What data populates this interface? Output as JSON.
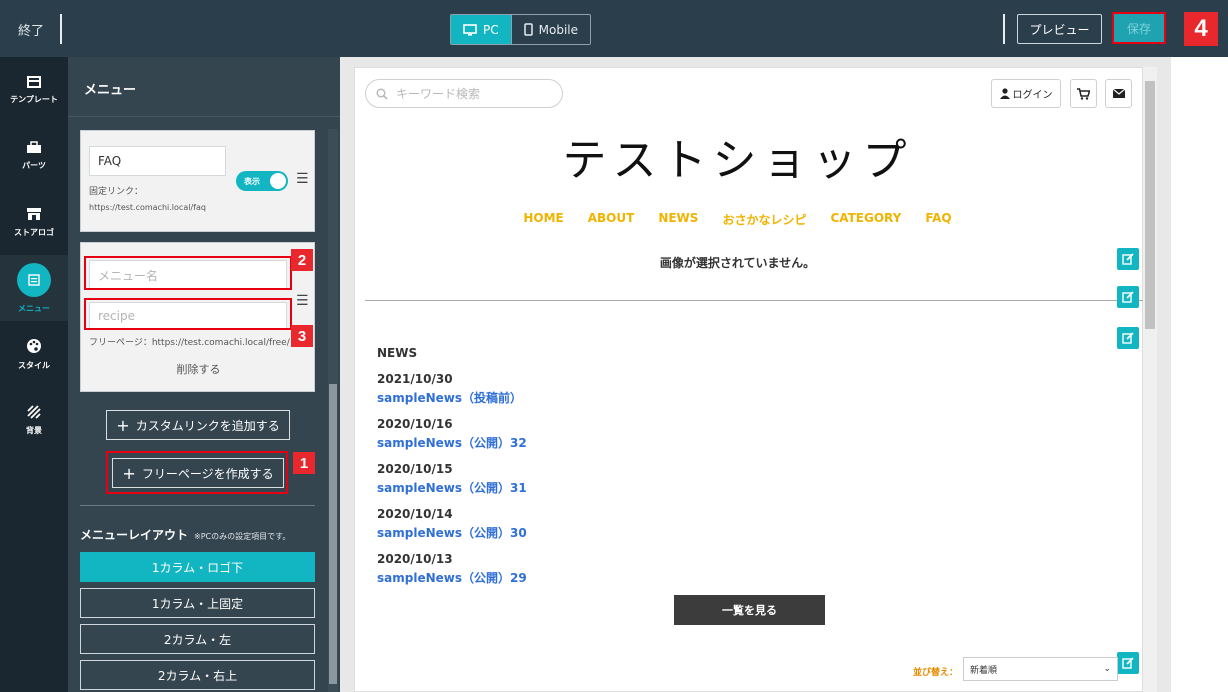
{
  "topbar": {
    "exit_label": "終了",
    "devices": [
      {
        "label": "PC",
        "icon": "monitor-icon",
        "active": true
      },
      {
        "label": "Mobile",
        "icon": "smartphone-icon",
        "active": false
      }
    ],
    "preview_label": "プレビュー",
    "save_label": "保存"
  },
  "annotations": {
    "n1": "1",
    "n2": "2",
    "n3": "3",
    "n4": "4"
  },
  "iconbar": {
    "items": [
      {
        "label": "テンプレート",
        "icon": "template-icon"
      },
      {
        "label": "パーツ",
        "icon": "parts-icon"
      },
      {
        "label": "ストアロゴ",
        "icon": "store-icon"
      },
      {
        "label": "メニュー",
        "icon": "menu-list-icon",
        "active": true
      },
      {
        "label": "スタイル",
        "icon": "palette-icon"
      },
      {
        "label": "背景",
        "icon": "background-icon"
      }
    ]
  },
  "panel": {
    "title": "メニュー",
    "faq_card": {
      "value": "FAQ",
      "fixed_link_label": "固定リンク：",
      "fixed_link_url": "https://test.comachi.local/faq",
      "toggle_label": "表示"
    },
    "new_card": {
      "name_placeholder": "メニュー名",
      "slug_placeholder": "recipe",
      "free_page_label": "フリーページ：https://test.comachi.local/free/",
      "delete_label": "削除する"
    },
    "add_custom_link": "カスタムリンクを追加する",
    "create_free_page": "フリーページを作成する",
    "layout_title": "メニューレイアウト",
    "layout_note": "※PCのみの設定項目です。",
    "layout_options": [
      "1カラム・ロゴ下",
      "1カラム・上固定",
      "2カラム・左",
      "2カラム・右上"
    ],
    "layout_selected": 0
  },
  "preview": {
    "search_placeholder": "キーワード検索",
    "login_label": "ログイン",
    "shop_title": "テストショップ",
    "nav": [
      "HOME",
      "ABOUT",
      "NEWS",
      "おさかなレシピ",
      "CATEGORY",
      "FAQ"
    ],
    "no_image": "画像が選択されていません。",
    "news_heading": "NEWS",
    "news": [
      {
        "date": "2021/10/30",
        "title": "sampleNews（投稿前）"
      },
      {
        "date": "2020/10/16",
        "title": "sampleNews（公開）32"
      },
      {
        "date": "2020/10/15",
        "title": "sampleNews（公開）31"
      },
      {
        "date": "2020/10/14",
        "title": "sampleNews（公開）30"
      },
      {
        "date": "2020/10/13",
        "title": "sampleNews（公開）29"
      }
    ],
    "list_button": "一覧を見る",
    "sort_label": "並び替え：",
    "sort_value": "新着順"
  }
}
